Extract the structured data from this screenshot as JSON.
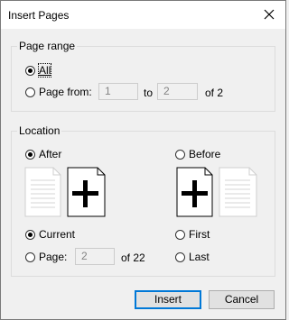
{
  "window": {
    "title": "Insert Pages"
  },
  "page_range": {
    "group_label": "Page range",
    "all_label": "All",
    "page_from_label": "Page from:",
    "from_value": "1",
    "to_label": "to",
    "to_value": "2",
    "of_label": "of 2",
    "selected": "All"
  },
  "location": {
    "group_label": "Location",
    "after_label": "After",
    "before_label": "Before",
    "current_label": "Current",
    "page_label": "Page:",
    "page_value": "2",
    "of_pages_label": "of 22",
    "first_label": "First",
    "last_label": "Last",
    "position_selected": "After",
    "target_selected": "Current"
  },
  "buttons": {
    "insert_label": "Insert",
    "cancel_label": "Cancel"
  },
  "icons": {
    "close": "close-icon",
    "plus_page": "plus-page-icon",
    "blank_page": "blank-page-icon"
  }
}
